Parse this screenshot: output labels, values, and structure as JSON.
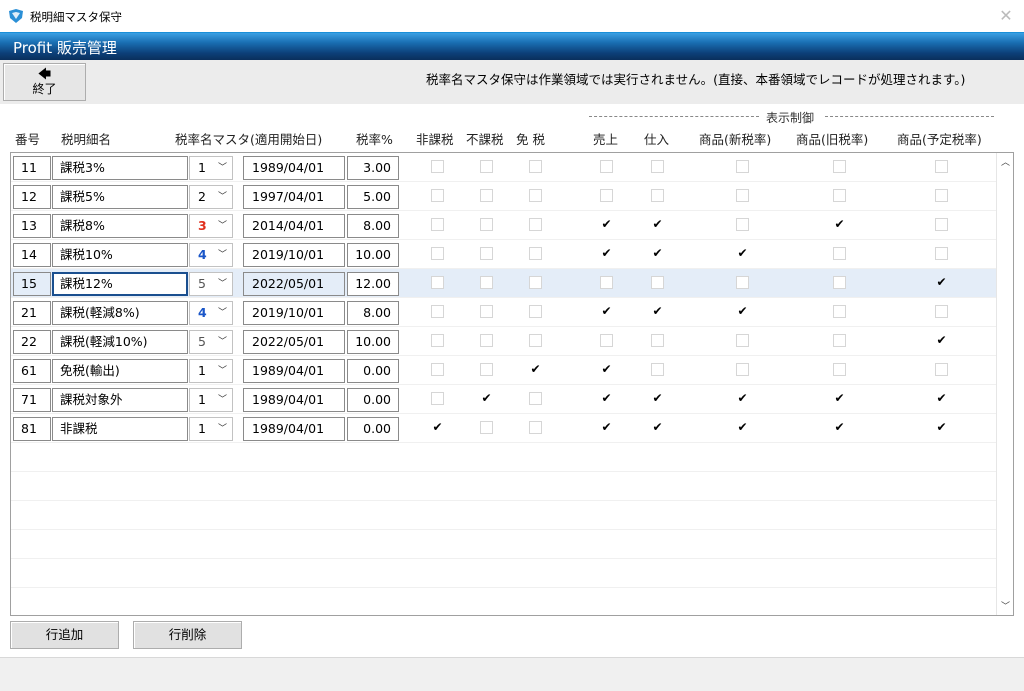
{
  "window": {
    "title": "税明細マスタ保守",
    "close_glyph": "✕"
  },
  "app": {
    "title": "Profit 販売管理"
  },
  "toolbar": {
    "exit_label": "終了",
    "exit_arrow": "🡄",
    "notice": "税率名マスタ保守は作業領域では実行されません。(直接、本番領域でレコードが処理されます。)"
  },
  "group_label": "表示制御",
  "columns": {
    "code": "番号",
    "name": "税明細名",
    "tax_master": "税率名マスタ(適用開始日)",
    "rate": "税率%",
    "hikazei": "非課税",
    "fukazei": "不課税",
    "menzei": "免 税",
    "sales": "売上",
    "purchase": "仕入",
    "item_new": "商品(新税率)",
    "item_old": "商品(旧税率)",
    "item_planned": "商品(予定税率)"
  },
  "accent_colors": {
    "red": "#e0301e",
    "blue": "#1a56c8",
    "default": "#000000",
    "muted": "#555555"
  },
  "rows": [
    {
      "code": "11",
      "name": "課税3%",
      "master": "1",
      "master_color": "default",
      "date": "1989/04/01",
      "rate": "3.00",
      "flags": [
        false,
        false,
        false,
        false,
        false,
        false,
        false,
        false
      ]
    },
    {
      "code": "12",
      "name": "課税5%",
      "master": "2",
      "master_color": "default",
      "date": "1997/04/01",
      "rate": "5.00",
      "flags": [
        false,
        false,
        false,
        false,
        false,
        false,
        false,
        false
      ]
    },
    {
      "code": "13",
      "name": "課税8%",
      "master": "3",
      "master_color": "red",
      "date": "2014/04/01",
      "rate": "8.00",
      "flags": [
        false,
        false,
        false,
        true,
        true,
        false,
        true,
        false
      ]
    },
    {
      "code": "14",
      "name": "課税10%",
      "master": "4",
      "master_color": "blue",
      "date": "2019/10/01",
      "rate": "10.00",
      "flags": [
        false,
        false,
        false,
        true,
        true,
        true,
        false,
        false
      ]
    },
    {
      "code": "15",
      "name": "課税12%",
      "master": "5",
      "master_color": "muted",
      "date": "2022/05/01",
      "rate": "12.00",
      "flags": [
        false,
        false,
        false,
        false,
        false,
        false,
        false,
        true
      ],
      "selected": true
    },
    {
      "code": "21",
      "name": "課税(軽減8%)",
      "master": "4",
      "master_color": "blue",
      "date": "2019/10/01",
      "rate": "8.00",
      "flags": [
        false,
        false,
        false,
        true,
        true,
        true,
        false,
        false
      ]
    },
    {
      "code": "22",
      "name": "課税(軽減10%)",
      "master": "5",
      "master_color": "muted",
      "date": "2022/05/01",
      "rate": "10.00",
      "flags": [
        false,
        false,
        false,
        false,
        false,
        false,
        false,
        true
      ]
    },
    {
      "code": "61",
      "name": "免税(輸出)",
      "master": "1",
      "master_color": "default",
      "date": "1989/04/01",
      "rate": "0.00",
      "flags": [
        false,
        false,
        true,
        true,
        false,
        false,
        false,
        false
      ]
    },
    {
      "code": "71",
      "name": "課税対象外",
      "master": "1",
      "master_color": "default",
      "date": "1989/04/01",
      "rate": "0.00",
      "flags": [
        false,
        true,
        false,
        true,
        true,
        true,
        true,
        true
      ]
    },
    {
      "code": "81",
      "name": "非課税",
      "master": "1",
      "master_color": "default",
      "date": "1989/04/01",
      "rate": "0.00",
      "flags": [
        true,
        false,
        false,
        true,
        true,
        true,
        true,
        true
      ]
    }
  ],
  "check_glyph": "✔",
  "combo_arrow": "﹀",
  "scroll": {
    "up": "︿",
    "down": "﹀"
  },
  "buttons": {
    "add_row": "行追加",
    "delete_row": "行削除"
  }
}
